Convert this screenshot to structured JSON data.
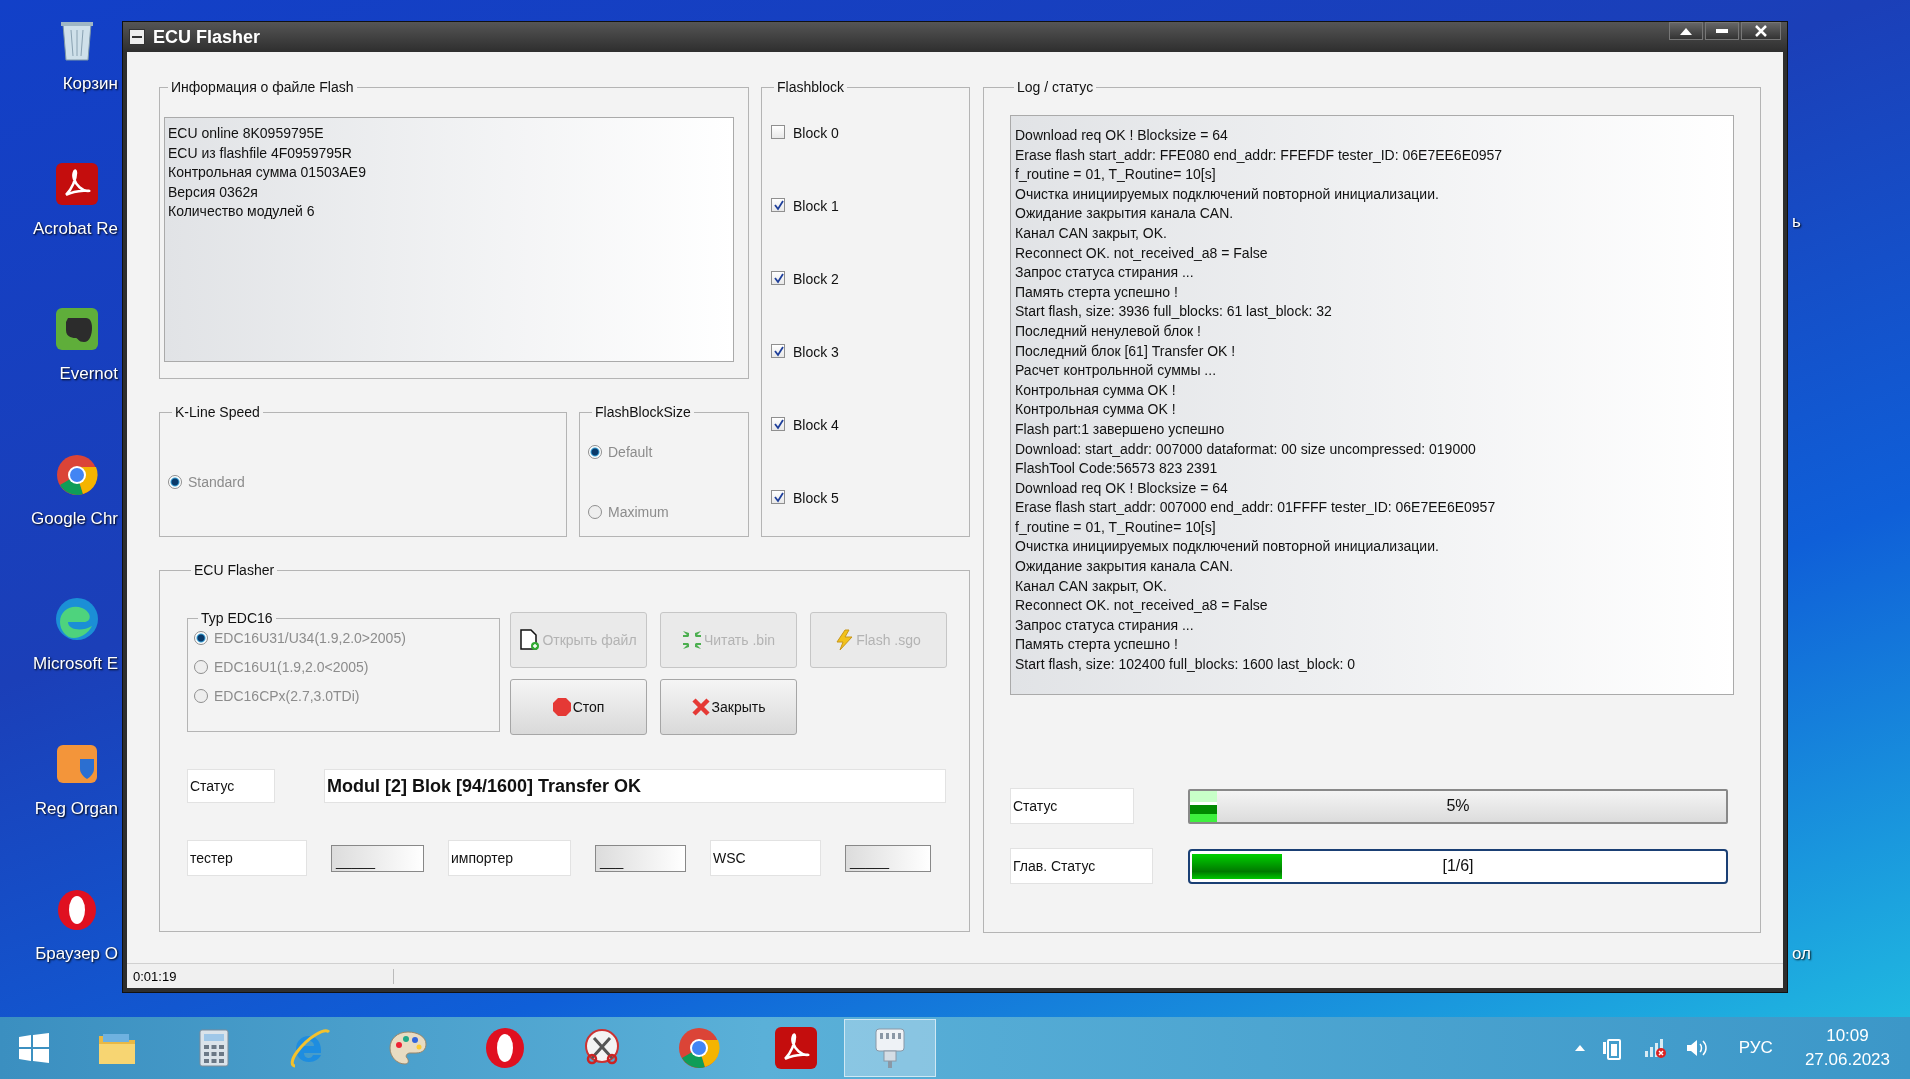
{
  "desktop": {
    "icons": [
      {
        "kind": "recycle",
        "label": "Корзин"
      },
      {
        "kind": "acrobat",
        "label": "Acrobat Re"
      },
      {
        "kind": "evernote",
        "label": "Evernot"
      },
      {
        "kind": "chrome",
        "label": "Google Chr"
      },
      {
        "kind": "edge",
        "label": "Microsoft E"
      },
      {
        "kind": "regorg",
        "label": "Reg Organ"
      },
      {
        "kind": "opera",
        "label": "Браузер O"
      }
    ],
    "right_labels": [
      "ь",
      "ол"
    ]
  },
  "window": {
    "title": "ECU Flasher"
  },
  "flash_info": {
    "title": "Информация  о файле Flash",
    "lines": [
      "ECU online 8K0959795E",
      "ECU из flashfile 4F0959795R",
      "Контрольная сумма 01503AE9",
      "Версия 0362я",
      "Количество модулей 6"
    ]
  },
  "flashblock": {
    "title": "Flashblock",
    "items": [
      {
        "label": "Block 0",
        "checked": false
      },
      {
        "label": "Block 1",
        "checked": true
      },
      {
        "label": "Block 2",
        "checked": true
      },
      {
        "label": "Block 3",
        "checked": true
      },
      {
        "label": "Block 4",
        "checked": true
      },
      {
        "label": "Block 5",
        "checked": true
      }
    ]
  },
  "kline_speed": {
    "title": "K-Line Speed",
    "disabled": true,
    "options": [
      {
        "label": "Standard",
        "selected": true
      }
    ]
  },
  "flash_block_size": {
    "title": "FlashBlockSize",
    "disabled": true,
    "options": [
      {
        "label": "Default",
        "selected": true
      },
      {
        "label": "Maximum",
        "selected": false
      }
    ]
  },
  "ecu_flasher": {
    "title": "ECU Flasher",
    "edc16": {
      "title": "Typ EDC16",
      "disabled": true,
      "options": [
        {
          "label": "EDC16U31/U34(1.9,2.0>2005)",
          "selected": true
        },
        {
          "label": "EDC16U1(1.9,2.0<2005)",
          "selected": false
        },
        {
          "label": "EDC16CPx(2.7,3.0TDi)",
          "selected": false
        }
      ]
    },
    "buttons": [
      {
        "kind": "open",
        "label": "Открыть файл",
        "disabled": true
      },
      {
        "kind": "read",
        "label": "Читать .bin",
        "disabled": true
      },
      {
        "kind": "flash",
        "label": "Flash .sgo",
        "disabled": true
      },
      {
        "kind": "stop",
        "label": "Стоп",
        "disabled": false
      },
      {
        "kind": "close",
        "label": "Закрыть",
        "disabled": false
      }
    ],
    "status_label": "Статус",
    "status_value": "Modul [2] Blok [94/1600] Transfer OK",
    "fields": [
      {
        "label": "тестер",
        "value": "_____"
      },
      {
        "label": "импортер",
        "value": "___"
      },
      {
        "label": "WSC",
        "value": "_____"
      }
    ]
  },
  "log": {
    "title": "Log / статус",
    "lines": [
      "Download req OK ! Blocksize = 64",
      "Erase flash start_addr: FFE080 end_addr: FFEFDF tester_ID: 06E7EE6E0957",
      "f_routine = 01, T_Routine= 10[s]",
      "Очистка инициируемых подключений повторной инициализации.",
      "Ожидание закрытия канала CAN.",
      "Канал CAN закрыт, OK.",
      "Reconnect OK. not_received_a8 = False",
      "Запрос статуса стирания ...",
      "Память стерта успешно !",
      "Start flash, size: 3936 full_blocks: 61 last_block: 32",
      "Последний ненулевой блок !",
      "Последний блок [61] Transfer OK !",
      "Расчет контрольнной суммы ...",
      "Контрольная сумма OK !",
      "Контрольная сумма OK !",
      "Flash part:1 завершено успешно",
      "Download: start_addr: 007000 dataformat: 00 size uncompressed: 019000",
      "FlashTool Code:56573 823 2391",
      "Download req OK ! Blocksize = 64",
      "Erase flash start_addr: 007000 end_addr: 01FFFF tester_ID: 06E7EE6E0957",
      "f_routine = 01, T_Routine= 10[s]",
      "Очистка инициируемых подключений повторной инициализации.",
      "Ожидание закрытия канала CAN.",
      "Канал CAN закрыт, OK.",
      "Reconnect OK. not_received_a8 = False",
      "Запрос статуса стирания ...",
      "Память стерта успешно !",
      "Start flash, size: 102400 full_blocks: 1600 last_block: 0"
    ],
    "progress": [
      {
        "kind": "classic",
        "label": "Статус",
        "level": 0.05,
        "text": "5%"
      },
      {
        "kind": "focused",
        "label": "Глав. Статус",
        "level": 0.167,
        "text": "[1/6]"
      }
    ]
  },
  "status_bar": {
    "elapsed": "0:01:19"
  },
  "taskbar": {
    "apps": [
      {
        "kind": "folder",
        "selected": false
      },
      {
        "kind": "calculator",
        "selected": false
      },
      {
        "kind": "ie",
        "selected": false
      },
      {
        "kind": "paint",
        "selected": false
      },
      {
        "kind": "opera",
        "selected": false
      },
      {
        "kind": "snipping",
        "selected": false
      },
      {
        "kind": "chrome",
        "selected": false
      },
      {
        "kind": "acrobat",
        "selected": false
      },
      {
        "kind": "connector",
        "selected": true
      }
    ],
    "language": "РУС",
    "time": "10:09",
    "date": "27.06.2023"
  }
}
